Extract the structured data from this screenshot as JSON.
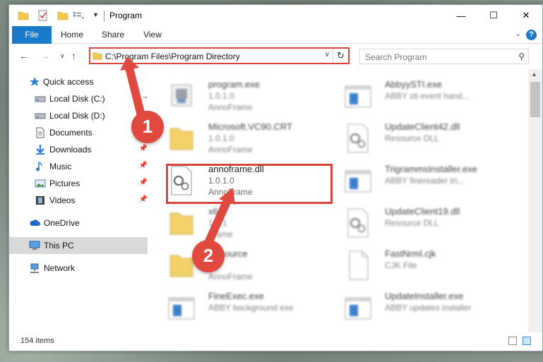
{
  "window": {
    "title": "Program",
    "controls": {
      "minimize": "—",
      "maximize": "☐",
      "close": "✕"
    }
  },
  "ribbon": {
    "tabs": [
      "File",
      "Home",
      "Share",
      "View"
    ],
    "help": "?"
  },
  "address_bar": {
    "path": "C:\\Program Files\\Program Directory"
  },
  "search": {
    "placeholder": "Search Program"
  },
  "sidebar": {
    "items": [
      {
        "label": "Quick access",
        "icon": "star-icon",
        "pinned": false
      },
      {
        "label": "Local Disk (C:)",
        "icon": "drive-icon",
        "pinned": true
      },
      {
        "label": "Local Disk (D:)",
        "icon": "drive-icon",
        "pinned": true
      },
      {
        "label": "Documents",
        "icon": "document-icon",
        "pinned": true
      },
      {
        "label": "Downloads",
        "icon": "download-icon",
        "pinned": true
      },
      {
        "label": "Music",
        "icon": "music-icon",
        "pinned": true
      },
      {
        "label": "Pictures",
        "icon": "pictures-icon",
        "pinned": true
      },
      {
        "label": "Videos",
        "icon": "video-icon",
        "pinned": true
      },
      {
        "label": "OneDrive",
        "icon": "cloud-icon",
        "pinned": false
      },
      {
        "label": "This PC",
        "icon": "computer-icon",
        "pinned": false,
        "selected": true
      },
      {
        "label": "Network",
        "icon": "network-icon",
        "pinned": false
      }
    ],
    "pin_glyph": "📌"
  },
  "files": {
    "left": [
      {
        "name": "program.exe",
        "line1": "1.0.1.0",
        "line2": "AnnoFrame",
        "icon": "exe-icon"
      },
      {
        "name": "Microsoft.VC90.CRT",
        "line1": "1.0.1.0",
        "line2": "AnnoFrame",
        "icon": "folder-icon"
      },
      {
        "name": "annoframe.dll",
        "line1": "1.0.1.0",
        "line2": "AnnoFrame",
        "icon": "dll-gear-icon",
        "highlighted": true
      },
      {
        "name": "x64",
        "line1": "1.0.1",
        "line2": "Frame",
        "icon": "folder-icon"
      },
      {
        "name": "Resource",
        "line1": "",
        "line2": "AnnoFrame",
        "icon": "folder-icon"
      },
      {
        "name": "FineExec.exe",
        "line1": "ABBY background exe",
        "line2": "",
        "icon": "app-window-icon"
      }
    ],
    "right": [
      {
        "name": "AbbyySTI.exe",
        "line1": "ABBY sti event hand...",
        "line2": "",
        "icon": "app-window-icon"
      },
      {
        "name": "UpdateClient42.dll",
        "line1": "Resource DLL",
        "line2": "",
        "icon": "dll-gear-icon"
      },
      {
        "name": "TrigrammsInstaller.exe",
        "line1": "ABBY finereader tri...",
        "line2": "",
        "icon": "app-window-icon"
      },
      {
        "name": "UpdateClient19.dll",
        "line1": "Resource DLL",
        "line2": "",
        "icon": "dll-gear-icon"
      },
      {
        "name": "FastNrml.cjk",
        "line1": "CJK File",
        "line2": "",
        "icon": "blank-file-icon"
      },
      {
        "name": "UpdateInstaller.exe",
        "line1": "ABBY updates installer",
        "line2": "",
        "icon": "app-window-icon"
      }
    ]
  },
  "status_bar": {
    "item_count": "154 items"
  },
  "annotations": {
    "step1": "1",
    "step2": "2"
  },
  "colors": {
    "accent": "#1979ca",
    "highlight_red": "#d9453c",
    "callout_red": "#e0493f",
    "folder_yellow": "#f2c94c"
  }
}
